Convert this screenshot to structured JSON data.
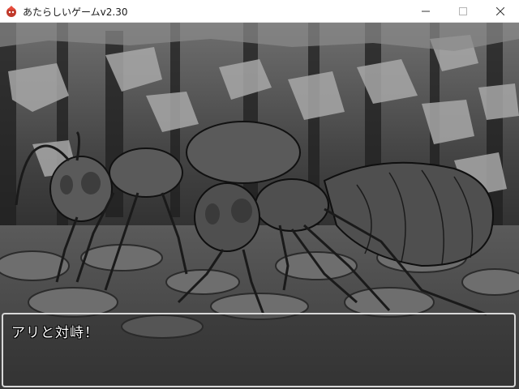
{
  "window": {
    "title": "あたらしいゲームv2.30",
    "app_icon": "rpg-app-icon",
    "controls": [
      "minimize-icon",
      "maximize-icon",
      "close-icon"
    ]
  },
  "scene": {
    "background": "cave-rock-wall-and-cobblestone-floor",
    "enemies": [
      "giant-ant",
      "giant-ant"
    ]
  },
  "message": {
    "text": "アリと対峙！"
  },
  "colors": {
    "titlebar_bg": "#ffffff",
    "message_border": "#d8d8d8",
    "message_text": "#ffffff"
  }
}
